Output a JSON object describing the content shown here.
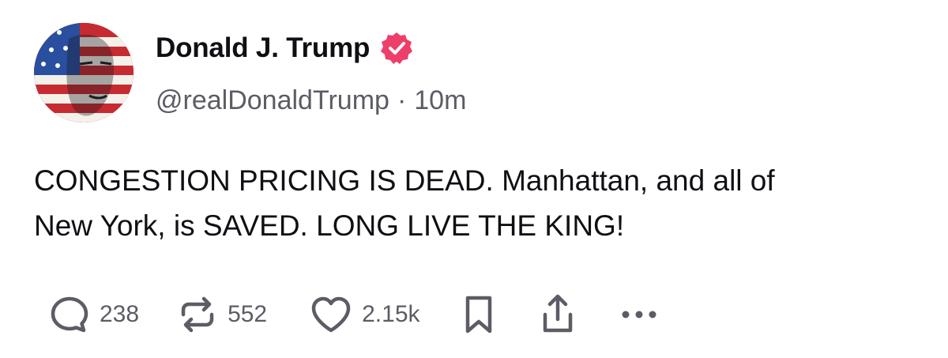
{
  "post": {
    "author": {
      "display_name": "Donald J. Trump",
      "handle": "@realDonaldTrump",
      "verified": true,
      "verified_color": "#ee3f6a",
      "avatar_icon": "flag-portrait-avatar"
    },
    "separator": "·",
    "timestamp": "10m",
    "text": "CONGESTION PRICING IS DEAD. Manhattan, and all of\nNew York, is SAVED. LONG LIVE THE KING!",
    "actions": {
      "reply": {
        "icon": "reply-icon",
        "count": "238"
      },
      "repost": {
        "icon": "repost-icon",
        "count": "552"
      },
      "like": {
        "icon": "heart-icon",
        "count": "2.15k"
      },
      "bookmark": {
        "icon": "bookmark-icon"
      },
      "share": {
        "icon": "share-icon"
      },
      "more": {
        "icon": "more-icon"
      }
    }
  },
  "colors": {
    "text_primary": "#0f0f14",
    "text_secondary": "#5c5c66",
    "icon": "#5c5c66",
    "flag_red": "#b22234",
    "flag_blue": "#2a4f9e"
  }
}
